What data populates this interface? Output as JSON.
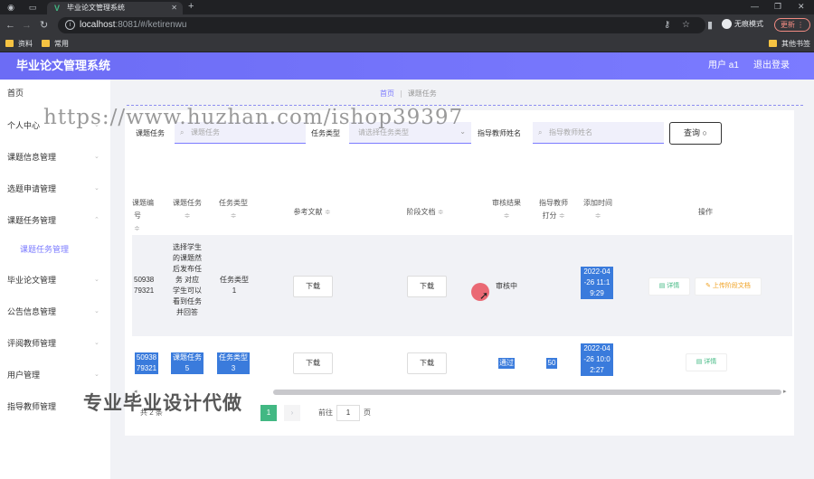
{
  "browser": {
    "tab_title": "毕业论文管理系统",
    "url_host": "localhost",
    "url_rest": ":8081/#/ketirenwu",
    "incognito_label": "无痕模式",
    "update_label": "更新",
    "bookmarks": [
      "资料",
      "常用"
    ],
    "other_bookmarks": "其他书签"
  },
  "header": {
    "title": "毕业论文管理系统",
    "user": "用户 a1",
    "logout": "退出登录"
  },
  "sidebar": {
    "items": [
      {
        "label": "首页"
      },
      {
        "label": "个人中心"
      },
      {
        "label": "课题信息管理"
      },
      {
        "label": "选题申请管理"
      },
      {
        "label": "课题任务管理"
      },
      {
        "label": "课题任务管理"
      },
      {
        "label": "毕业论文管理"
      },
      {
        "label": "公告信息管理"
      },
      {
        "label": "评阅教师管理"
      },
      {
        "label": "用户管理"
      },
      {
        "label": "指导教师管理"
      }
    ]
  },
  "breadcrumb": {
    "home": "首页",
    "current": "课题任务"
  },
  "search": {
    "task_label": "课题任务",
    "task_placeholder": "课题任务",
    "type_label": "任务类型",
    "type_placeholder": "请选择任务类型",
    "teacher_label": "指导教师姓名",
    "teacher_placeholder": "指导教师姓名",
    "query_button": "查询"
  },
  "table": {
    "headers": {
      "no": "课题编号",
      "task": "课题任务",
      "type": "任务类型",
      "ref": "参考文献",
      "stage": "阶段文档",
      "result": "审核结果",
      "score": "指导教师打分",
      "time": "添加时间",
      "ops": "操作"
    },
    "download_label": "下载",
    "detail_label": "详情",
    "upload_label": "上传阶段文档",
    "rows": [
      {
        "no_l1": "50938",
        "no_l2": "79321",
        "task_lines": [
          "选择学生",
          "的课题然",
          "后发布任",
          "务 对应",
          "学生可以",
          "看到任务",
          "并回答"
        ],
        "type_l1": "任务类型",
        "type_l2": "1",
        "result": "审核中",
        "score": "",
        "time_lines": [
          "2022-04",
          "-26 11:1",
          "9:29"
        ]
      },
      {
        "no_l1": "50938",
        "no_l2": "79321",
        "task_lines": [
          "课题任务",
          "5"
        ],
        "type_l1": "任务类型",
        "type_l2": "3",
        "result": "通过",
        "score": "50",
        "time_lines": [
          "2022-04",
          "-26 10:0",
          "2:27"
        ]
      }
    ]
  },
  "pagination": {
    "total": "共 2 条",
    "page": "1",
    "goto_prefix": "前往",
    "goto_value": "1",
    "goto_suffix": "页"
  },
  "watermark": {
    "url": "https://www.huzhan.com/ishop39397",
    "text": "专业毕业设计代做"
  },
  "colors": {
    "accent": "#7b7bff",
    "selection": "#3a7bdc",
    "page_active": "#42b883",
    "warning": "#f0a020"
  }
}
